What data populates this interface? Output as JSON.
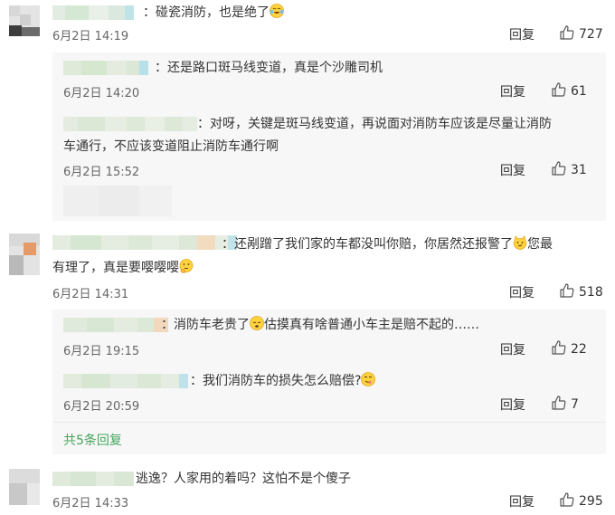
{
  "labels": {
    "reply": "回复"
  },
  "colors": {
    "link_green": "#44a55d",
    "reply_bg": "#f7f7f7"
  },
  "comments": [
    {
      "text": "：碰瓷消防，也是绝了",
      "emoji": "crying-laughing-emoji",
      "time": "6月2日 14:19",
      "likes": "727",
      "replies": [
        {
          "text": "：还是路口斑马线变道，真是个沙雕司机",
          "time": "6月2日 14:20",
          "likes": "61"
        },
        {
          "text_line1": "：对呀，关键是斑马线变道，再说面对消防车应该是尽量让消防",
          "text_line2": "车通行，不应该变道阻止消防车通行啊",
          "time": "6月2日 15:52",
          "likes": "31"
        }
      ]
    },
    {
      "text_line1_a": "：还剐蹭了我们家的车都没叫你赔，你居然还报警了",
      "text_line1_b": "您最",
      "text_line2": "有理了，真是要嘤嘤嘤",
      "time": "6月2日 14:31",
      "likes": "518",
      "replies": [
        {
          "text_a": "：消防车老贵了",
          "text_b": "估摸真有啥普通小车主是赔不起的……",
          "time": "6月2日 19:15",
          "likes": "22"
        },
        {
          "text": "：我们消防车的损失怎么赔偿?",
          "time": "6月2日 20:59",
          "likes": "7"
        }
      ],
      "more": "共5条回复"
    },
    {
      "text": "逃逸？人家用的着吗？这怕不是个傻子",
      "time": "6月2日 14:33",
      "likes": "295"
    }
  ]
}
